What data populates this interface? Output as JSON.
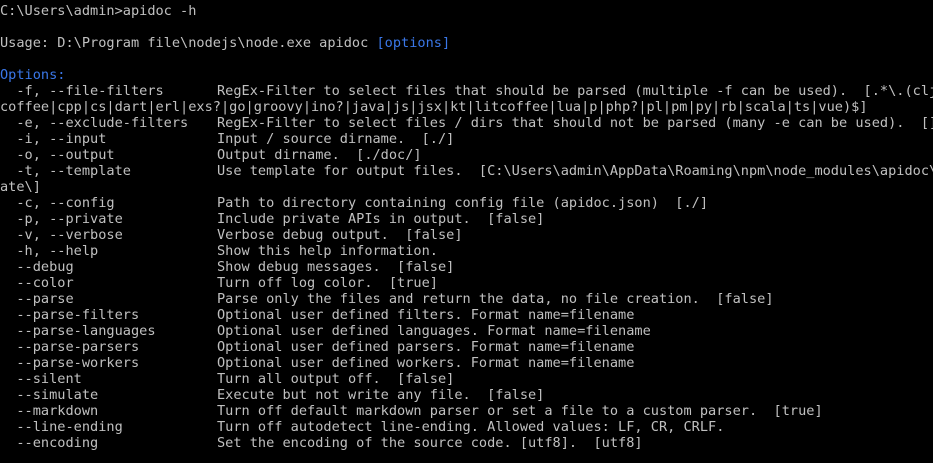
{
  "colors": {
    "background": "#000000",
    "text": "#c0c0c0",
    "highlight": "#3a77e8"
  },
  "terminal": {
    "prompt": "C:\\Users\\admin>apidoc -h",
    "usage_prefix": "Usage: D:\\Program file\\nodejs\\node.exe apidoc ",
    "usage_options": "[options]",
    "options_heading": "Options:",
    "options": [
      {
        "flag": "  -f, --file-filters",
        "desc": "RegEx-Filter to select files that should be parsed (multiple -f can be used).  [.*\\.(clj|cls",
        "wrap": "coffee|cpp|cs|dart|erl|exs?|go|groovy|ino?|java|js|jsx|kt|litcoffee|lua|p|php?|pl|pm|py|rb|scala|ts|vue)$]"
      },
      {
        "flag": "  -e, --exclude-filters",
        "desc": "RegEx-Filter to select files / dirs that should not be parsed (many -e can be used).  []"
      },
      {
        "flag": "  -i, --input",
        "desc": "Input / source dirname.  [./]"
      },
      {
        "flag": "  -o, --output",
        "desc": "Output dirname.  [./doc/]"
      },
      {
        "flag": "  -t, --template",
        "desc": "Use template for output files.  [C:\\Users\\admin\\AppData\\Roaming\\npm\\node_modules\\apidoc\\templ",
        "wrap": "ate\\]"
      },
      {
        "flag": "  -c, --config",
        "desc": "Path to directory containing config file (apidoc.json)  [./]"
      },
      {
        "flag": "  -p, --private",
        "desc": "Include private APIs in output.  [false]"
      },
      {
        "flag": "  -v, --verbose",
        "desc": "Verbose debug output.  [false]"
      },
      {
        "flag": "  -h, --help",
        "desc": "Show this help information."
      },
      {
        "flag": "  --debug",
        "desc": "Show debug messages.  [false]"
      },
      {
        "flag": "  --color",
        "desc": "Turn off log color.  [true]"
      },
      {
        "flag": "  --parse",
        "desc": "Parse only the files and return the data, no file creation.  [false]"
      },
      {
        "flag": "  --parse-filters",
        "desc": "Optional user defined filters. Format name=filename"
      },
      {
        "flag": "  --parse-languages",
        "desc": "Optional user defined languages. Format name=filename"
      },
      {
        "flag": "  --parse-parsers",
        "desc": "Optional user defined parsers. Format name=filename"
      },
      {
        "flag": "  --parse-workers",
        "desc": "Optional user defined workers. Format name=filename"
      },
      {
        "flag": "  --silent",
        "desc": "Turn all output off.  [false]"
      },
      {
        "flag": "  --simulate",
        "desc": "Execute but not write any file.  [false]"
      },
      {
        "flag": "  --markdown",
        "desc": "Turn off default markdown parser or set a file to a custom parser.  [true]"
      },
      {
        "flag": "  --line-ending",
        "desc": "Turn off autodetect line-ending. Allowed values: LF, CR, CRLF."
      },
      {
        "flag": "  --encoding",
        "desc": "Set the encoding of the source code. [utf8].  [utf8]"
      }
    ]
  }
}
